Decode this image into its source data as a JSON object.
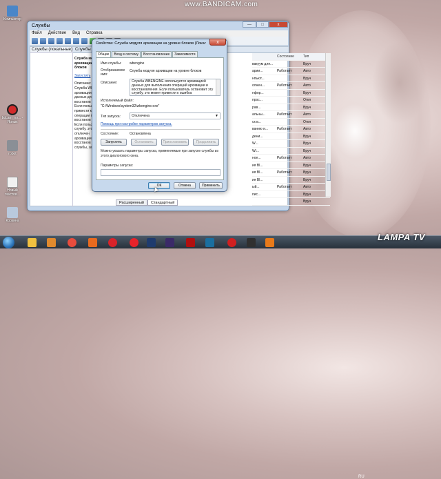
{
  "watermark": "www.BANDICAM.com",
  "desktop_icons": [
    {
      "label": "Компьютер",
      "color": "#4a86c8"
    },
    {
      "label": "bdcam_no... - Ярлык",
      "color": "#d22b2b"
    },
    {
      "label": "robot",
      "color": "#8a8f96"
    },
    {
      "label": "Новый текстов...",
      "color": "#f0f0f0"
    },
    {
      "label": "Корзина",
      "color": "#b9c9dd"
    }
  ],
  "services_window": {
    "title": "Службы",
    "controls": {
      "minimize": "—",
      "maximize": "□",
      "close": "x"
    },
    "menu": [
      "Файл",
      "Действие",
      "Вид",
      "Справка"
    ],
    "left_pane_title": "Службы (локальные)",
    "mid_pane_title": "Службы (локальные)",
    "description": {
      "heading": "Служба модуля архивации на уровне блоков",
      "start_link": "Запустить",
      "label": "Описание:",
      "lines": [
        "Служба WBE",
        "архивации",
        "данных для",
        "восстанов",
        "Если пользо",
        "привести к",
        "операции п",
        "восстанов",
        "Если пользо",
        "службу, это",
        "отключен",
        "архивации",
        "восстанов",
        "службы, за"
      ]
    },
    "list": {
      "headers": [
        "",
        "Состояние",
        "Тип"
      ],
      "rows": [
        [
          "вакуум для...",
          "",
          "Вруч"
        ],
        [
          "арии...",
          "Работает",
          "Авто"
        ],
        [
          "нпьют...",
          "",
          "Вруч"
        ],
        [
          "олнен...",
          "Работает",
          "Авто"
        ],
        [
          "нфор...",
          "",
          "Вруч"
        ],
        [
          "прос...",
          "",
          "Откл"
        ],
        [
          "рав...",
          "",
          "Вруч"
        ],
        [
          "альны...",
          "Работает",
          "Авто"
        ],
        [
          "ск в...",
          "",
          "Откл"
        ],
        [
          "ванию и...",
          "Работает",
          "Авто"
        ],
        [
          "дени...",
          "",
          "Вруч"
        ],
        [
          "W...",
          "",
          "Вруч"
        ],
        [
          "Wi...",
          "",
          "Вруч"
        ],
        [
          "ное...",
          "Работает",
          "Авто"
        ],
        [
          "ия Bl...",
          "",
          "Вруч"
        ],
        [
          "ия Bl...",
          "Работает",
          "Вруч"
        ],
        [
          "ия Bl...",
          "",
          "Вруч"
        ],
        [
          "ый...",
          "Работает",
          "Авто"
        ],
        [
          "пис...",
          "",
          "Вруч"
        ],
        [
          "",
          "",
          "Вруч"
        ]
      ]
    },
    "bottom_tabs": [
      "Расширенный",
      "Стандартный"
    ]
  },
  "dialog": {
    "title": "Свойства: Служба модуля архивации на уровне блоков (Локал...",
    "close": "x",
    "tabs": [
      "Общие",
      "Вход в систему",
      "Восстановление",
      "Зависимости"
    ],
    "service_name_label": "Имя службы:",
    "service_name": "wbengine",
    "display_name_label": "Отображаемое имя:",
    "display_name": "Служба модуля архивации на уровне блоков",
    "description_label": "Описание:",
    "description": "Служба WBENGINE используется архивацией данных для выполнения операций архивации и восстановления. Если пользователь остановит эту службу, это может привести к ошибка",
    "exe_label": "Исполняемый файл:",
    "exe_path": "\"C:\\Windows\\system32\\wbengine.exe\"",
    "startup_label": "Тип запуска:",
    "startup_value": "Отключена",
    "help_link": "Помощь при настройке параметров запуска.",
    "status_label": "Состояние:",
    "status_value": "Остановлена",
    "buttons": {
      "start": "Запустить",
      "stop": "Остановить",
      "pause": "Приостановить",
      "resume": "Продолжить"
    },
    "hint": "Можно указать параметры запуска, применяемые при запуске службы из этого диалогового окна.",
    "params_label": "Параметры запуска:",
    "ok": "ОК",
    "cancel": "Отмена",
    "apply": "Применить"
  },
  "taskbar": {
    "icons": [
      "explorer",
      "media-player",
      "chrome",
      "firefox",
      "opera",
      "yandex",
      "ps",
      "ae",
      "flash",
      "v-app",
      "record",
      "bandicam",
      "music"
    ],
    "lang": "RU",
    "brand": "LAMPA TV"
  },
  "colors": {
    "accent": "#1c54b6",
    "close": "#c74a35"
  }
}
